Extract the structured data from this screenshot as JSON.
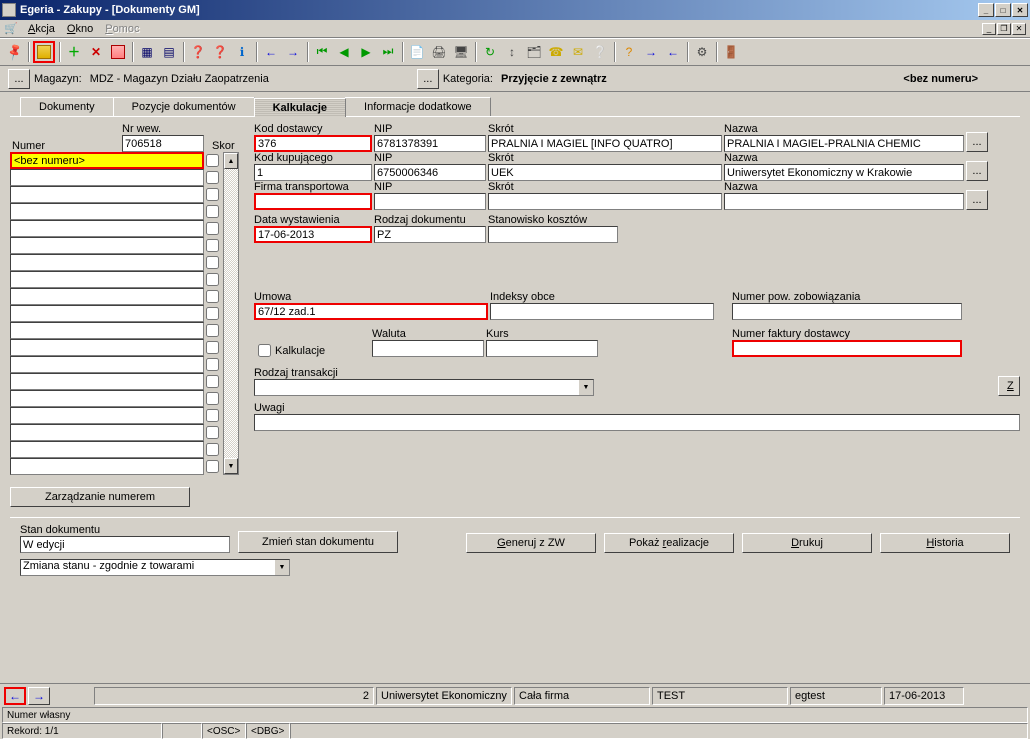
{
  "titlebar": {
    "text": "Egeria - Zakupy - [Dokumenty GM]"
  },
  "menu": {
    "akcja": "Akcja",
    "okno": "Okno",
    "pomoc": "Pomoc"
  },
  "topinfo": {
    "magazyn_lbl": "Magazyn:",
    "magazyn_val": "MDZ - Magazyn Działu Zaopatrzenia",
    "kategoria_lbl": "Kategoria:",
    "kategoria_val": "Przyjęcie z zewnątrz",
    "bez_numeru": "<bez numeru>"
  },
  "tabs": {
    "dokumenty": "Dokumenty",
    "pozycje": "Pozycje dokumentów",
    "kalkulacje": "Kalkulacje",
    "info": "Informacje dodatkowe"
  },
  "left": {
    "numer_lbl": "Numer",
    "nrwew_lbl": "Nr wew.",
    "skor_lbl": "Skor",
    "nrwew_val": "706518",
    "numer_val": "<bez numeru>",
    "zarzadzanie_btn": "Zarządzanie numerem"
  },
  "form": {
    "kod_dost_lbl": "Kod dostawcy",
    "kod_dost_val": "376",
    "nip1_lbl": "NIP",
    "nip1_val": "6781378391",
    "skrot1_lbl": "Skrót",
    "skrot1_val": "PRALNIA I MAGIEL [INFO QUATRO]",
    "nazwa1_lbl": "Nazwa",
    "nazwa1_val": "PRALNIA I MAGIEL-PRALNIA CHEMIC",
    "kod_kup_lbl": "Kod kupującego",
    "kod_kup_val": "1",
    "nip2_val": "6750006346",
    "skrot2_val": "UEK",
    "nazwa2_val": "Uniwersytet Ekonomiczny w Krakowie",
    "firma_tr_lbl": "Firma transportowa",
    "firma_tr_val": "",
    "nip3_val": "",
    "skrot3_val": "",
    "nazwa3_val": "",
    "data_lbl": "Data wystawienia",
    "data_val": "17-06-2013",
    "rodzaj_dok_lbl": "Rodzaj dokumentu",
    "rodzaj_dok_val": "PZ",
    "stanowisko_lbl": "Stanowisko kosztów",
    "stanowisko_val": "",
    "umowa_lbl": "Umowa",
    "umowa_val": "67/12 zad.1",
    "indeksy_lbl": "Indeksy obce",
    "indeksy_val": "",
    "numpow_lbl": "Numer pow. zobowiązania",
    "numpow_val": "",
    "kalkulacje_chk": "Kalkulacje",
    "waluta_lbl": "Waluta",
    "waluta_val": "",
    "kurs_lbl": "Kurs",
    "kurs_val": "",
    "numfakt_lbl": "Numer faktury dostawcy",
    "numfakt_val": "",
    "rodzaj_tr_lbl": "Rodzaj transakcji",
    "rodzaj_tr_val": "",
    "z_btn": "Z",
    "uwagi_lbl": "Uwagi",
    "uwagi_val": ""
  },
  "bottom": {
    "stan_lbl": "Stan dokumentu",
    "stan_val": "W edycji",
    "zmien_btn": "Zmień stan dokumentu",
    "zmiana_combo": "Zmiana stanu - zgodnie z towarami",
    "generuj": "Generuj z ZW",
    "pokaz": "Pokaż realizacje",
    "drukuj": "Drukuj",
    "historia": "Historia"
  },
  "nav": {
    "cell1": "2",
    "cell2": "Uniwersytet Ekonomiczny",
    "cell3": "Cała firma",
    "cell4": "TEST",
    "cell5": "egtest",
    "cell6": "17-06-2013"
  },
  "status": {
    "numer_wlasny": "Numer własny",
    "rekord": "Rekord: 1/1",
    "osc": "<OSC>",
    "dbg": "<DBG>"
  }
}
